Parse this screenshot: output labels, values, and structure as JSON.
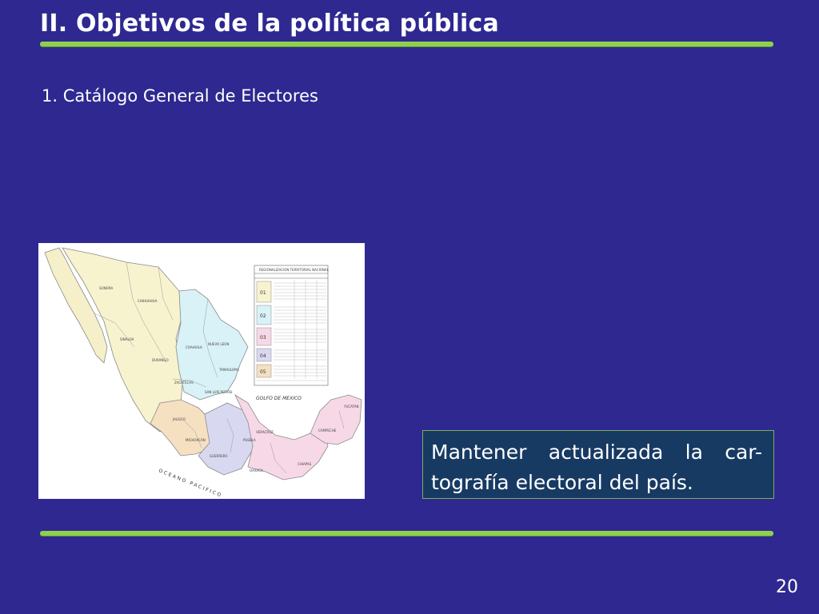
{
  "slide": {
    "title": "II. Objetivos de la política pública",
    "subtitle": "1. Catálogo General de Electores",
    "callout": "Mantener actualizada la car-tografía electoral del país.",
    "page_number": "20"
  },
  "map": {
    "gulf_label": "GOLFO DE MEXICO",
    "ocean_label": "OCEANO PACIFICO",
    "table_title": "REGIONALIZACION TERRITORIAL NACIONAL",
    "circunscriptions": [
      "01",
      "02",
      "03",
      "04",
      "05"
    ]
  },
  "colors": {
    "background": "#2e2890",
    "rule": "#8fd14f",
    "callout_bg": "#173a63"
  }
}
